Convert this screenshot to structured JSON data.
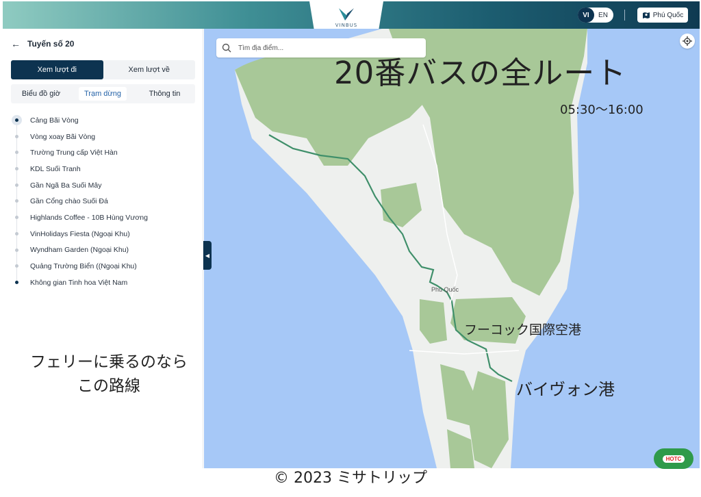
{
  "header": {
    "logo_text": "VINBUS",
    "lang_active": "VI",
    "lang_other": "EN",
    "region_label": "Phú Quốc",
    "brand_color": "#0d3350"
  },
  "sidebar": {
    "route_title": "Tuyến số 20",
    "direction_tabs": [
      "Xem lượt đi",
      "Xem lượt về"
    ],
    "sub_tabs": [
      "Biểu đồ giờ",
      "Trạm dừng",
      "Thông tin"
    ],
    "stops": [
      "Cảng Bãi Vòng",
      "Vòng xoay Bãi Vòng",
      "Trường Trung cấp Việt Hàn",
      "KDL Suối Tranh",
      "Gần Ngã Ba Suối Mây",
      "Gần Cổng chào Suối Đá",
      "Highlands Coffee - 10B Hùng Vương",
      "VinHolidays Fiesta (Ngoại Khu)",
      "Wyndham Garden (Ngoại Khu)",
      "Quảng Trường Biển ((Ngoại Khu)",
      "Không gian Tinh hoa Việt Nam"
    ],
    "note_line1": "フェリーに乗るのなら",
    "note_line2": "この路線"
  },
  "map": {
    "search_placeholder": "Tìm địa điểm...",
    "title_overlay": "20番バスの全ルート",
    "hours_overlay": "05:30〜16:00",
    "town_label": "Phú Quốc",
    "airport_label": "フーコック国際空港",
    "port_label": "バイヴォン港",
    "badge_text": "HOTC",
    "water_color": "#a6c8f7",
    "land_color": "#eef0ee",
    "forest_color": "#a8c898",
    "route_color": "#3f8f6a"
  },
  "footer": {
    "copyright": "© 2023 ミサトリップ"
  }
}
